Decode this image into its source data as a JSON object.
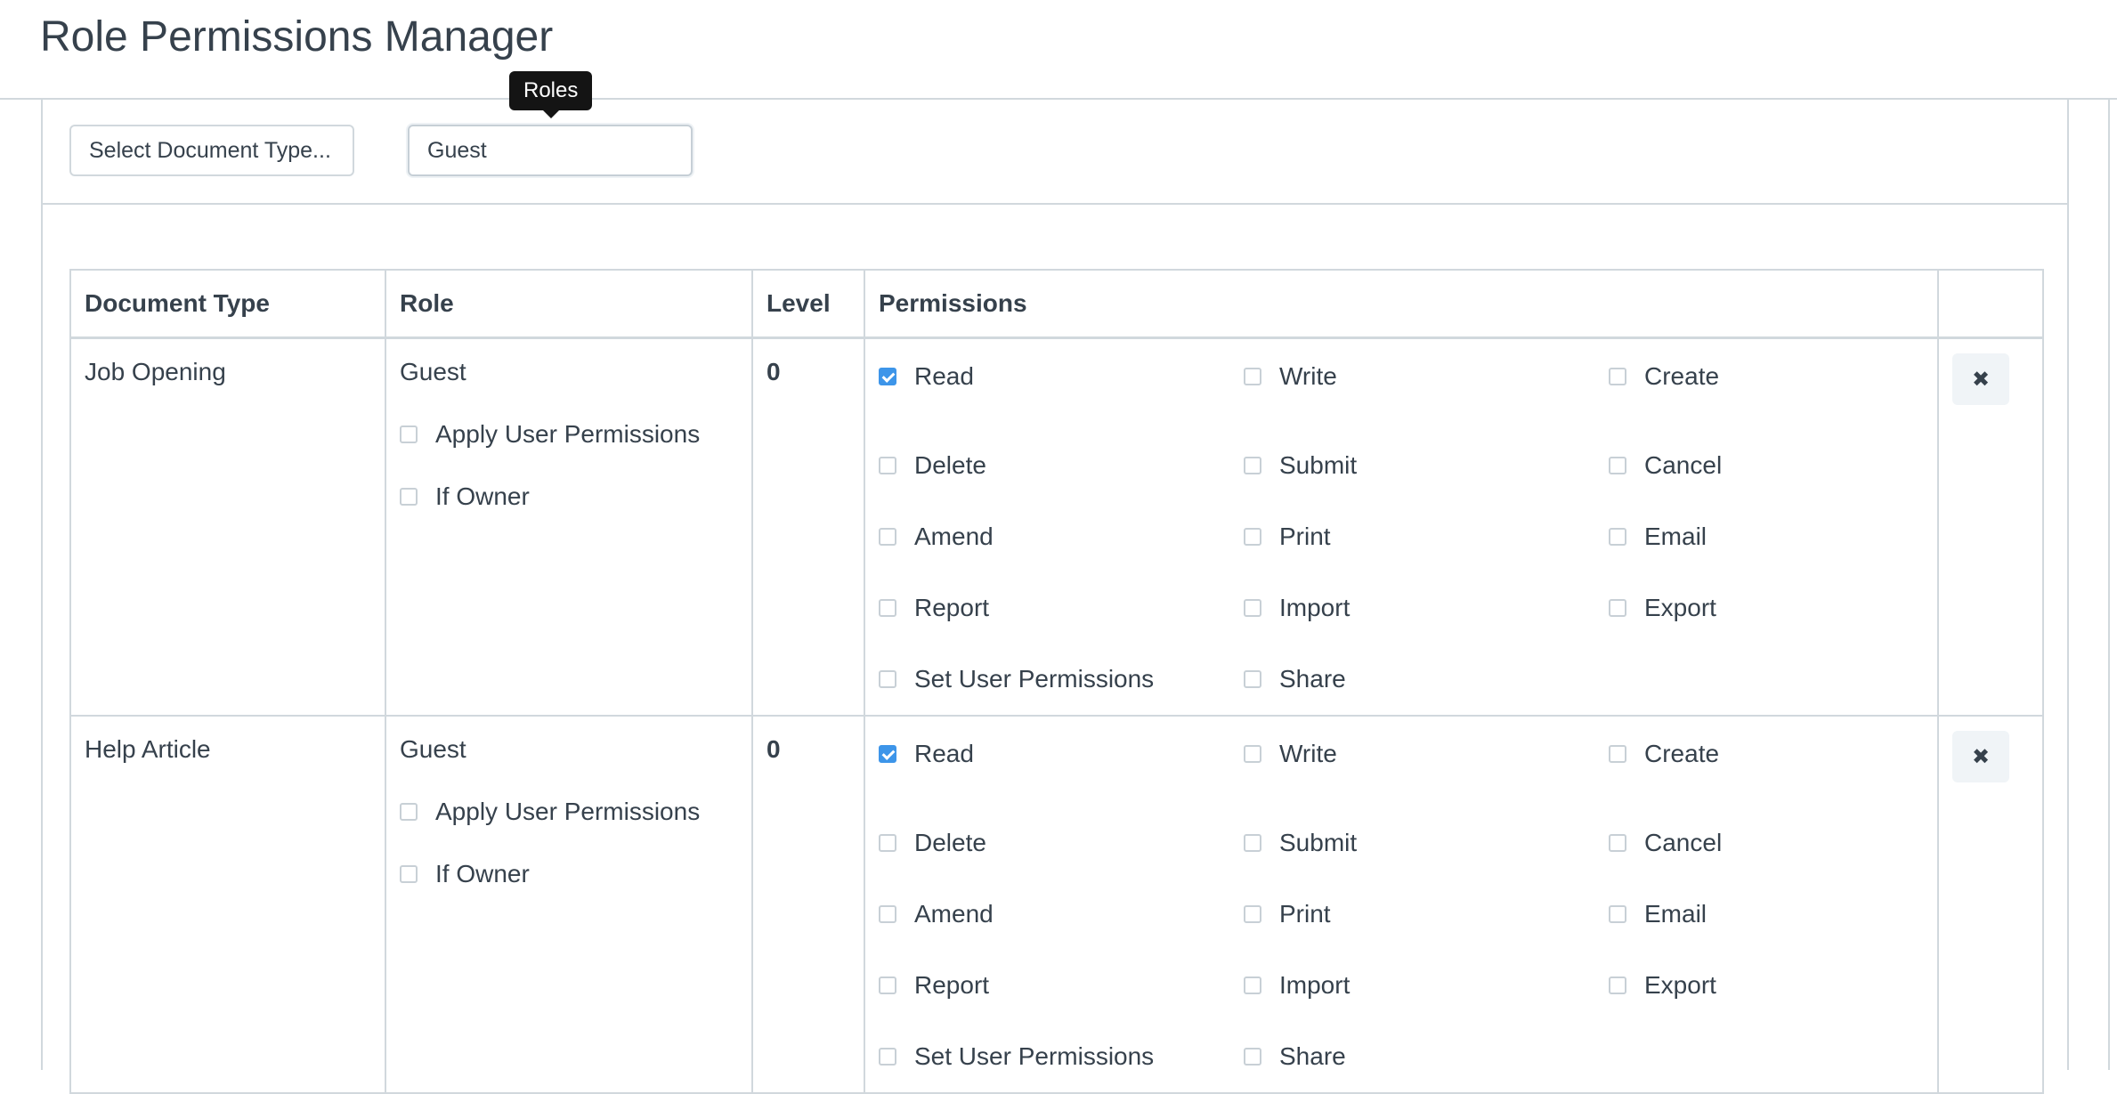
{
  "page": {
    "title": "Role Permissions Manager"
  },
  "filters": {
    "doctype_placeholder": "Select Document Type...",
    "role_value": "Guest",
    "role_tooltip": "Roles"
  },
  "table": {
    "headers": [
      "Document Type",
      "Role",
      "Level",
      "Permissions",
      ""
    ],
    "rows": [
      {
        "doctype": "Job Opening",
        "role": "Guest",
        "apply_user_permissions": {
          "label": "Apply User Permissions",
          "checked": false
        },
        "if_owner": {
          "label": "If Owner",
          "checked": false
        },
        "level": "0",
        "permissions": [
          {
            "label": "Read",
            "checked": true
          },
          {
            "label": "Write",
            "checked": false
          },
          {
            "label": "Create",
            "checked": false
          },
          {
            "label": "Delete",
            "checked": false
          },
          {
            "label": "Submit",
            "checked": false
          },
          {
            "label": "Cancel",
            "checked": false
          },
          {
            "label": "Amend",
            "checked": false
          },
          {
            "label": "Print",
            "checked": false
          },
          {
            "label": "Email",
            "checked": false
          },
          {
            "label": "Report",
            "checked": false
          },
          {
            "label": "Import",
            "checked": false
          },
          {
            "label": "Export",
            "checked": false
          },
          {
            "label": "Set User Permissions",
            "checked": false
          },
          {
            "label": "Share",
            "checked": false
          }
        ],
        "remove_icon": "close-icon"
      },
      {
        "doctype": "Help Article",
        "role": "Guest",
        "apply_user_permissions": {
          "label": "Apply User Permissions",
          "checked": false
        },
        "if_owner": {
          "label": "If Owner",
          "checked": false
        },
        "level": "0",
        "permissions": [
          {
            "label": "Read",
            "checked": true
          },
          {
            "label": "Write",
            "checked": false
          },
          {
            "label": "Create",
            "checked": false
          },
          {
            "label": "Delete",
            "checked": false
          },
          {
            "label": "Submit",
            "checked": false
          },
          {
            "label": "Cancel",
            "checked": false
          },
          {
            "label": "Amend",
            "checked": false
          },
          {
            "label": "Print",
            "checked": false
          },
          {
            "label": "Email",
            "checked": false
          },
          {
            "label": "Report",
            "checked": false
          },
          {
            "label": "Import",
            "checked": false
          },
          {
            "label": "Export",
            "checked": false
          },
          {
            "label": "Set User Permissions",
            "checked": false
          },
          {
            "label": "Share",
            "checked": false
          }
        ],
        "remove_icon": "close-icon"
      }
    ]
  },
  "colors": {
    "accent": "#3d95e9",
    "border": "#d1d8dd",
    "text": "#36414c"
  }
}
